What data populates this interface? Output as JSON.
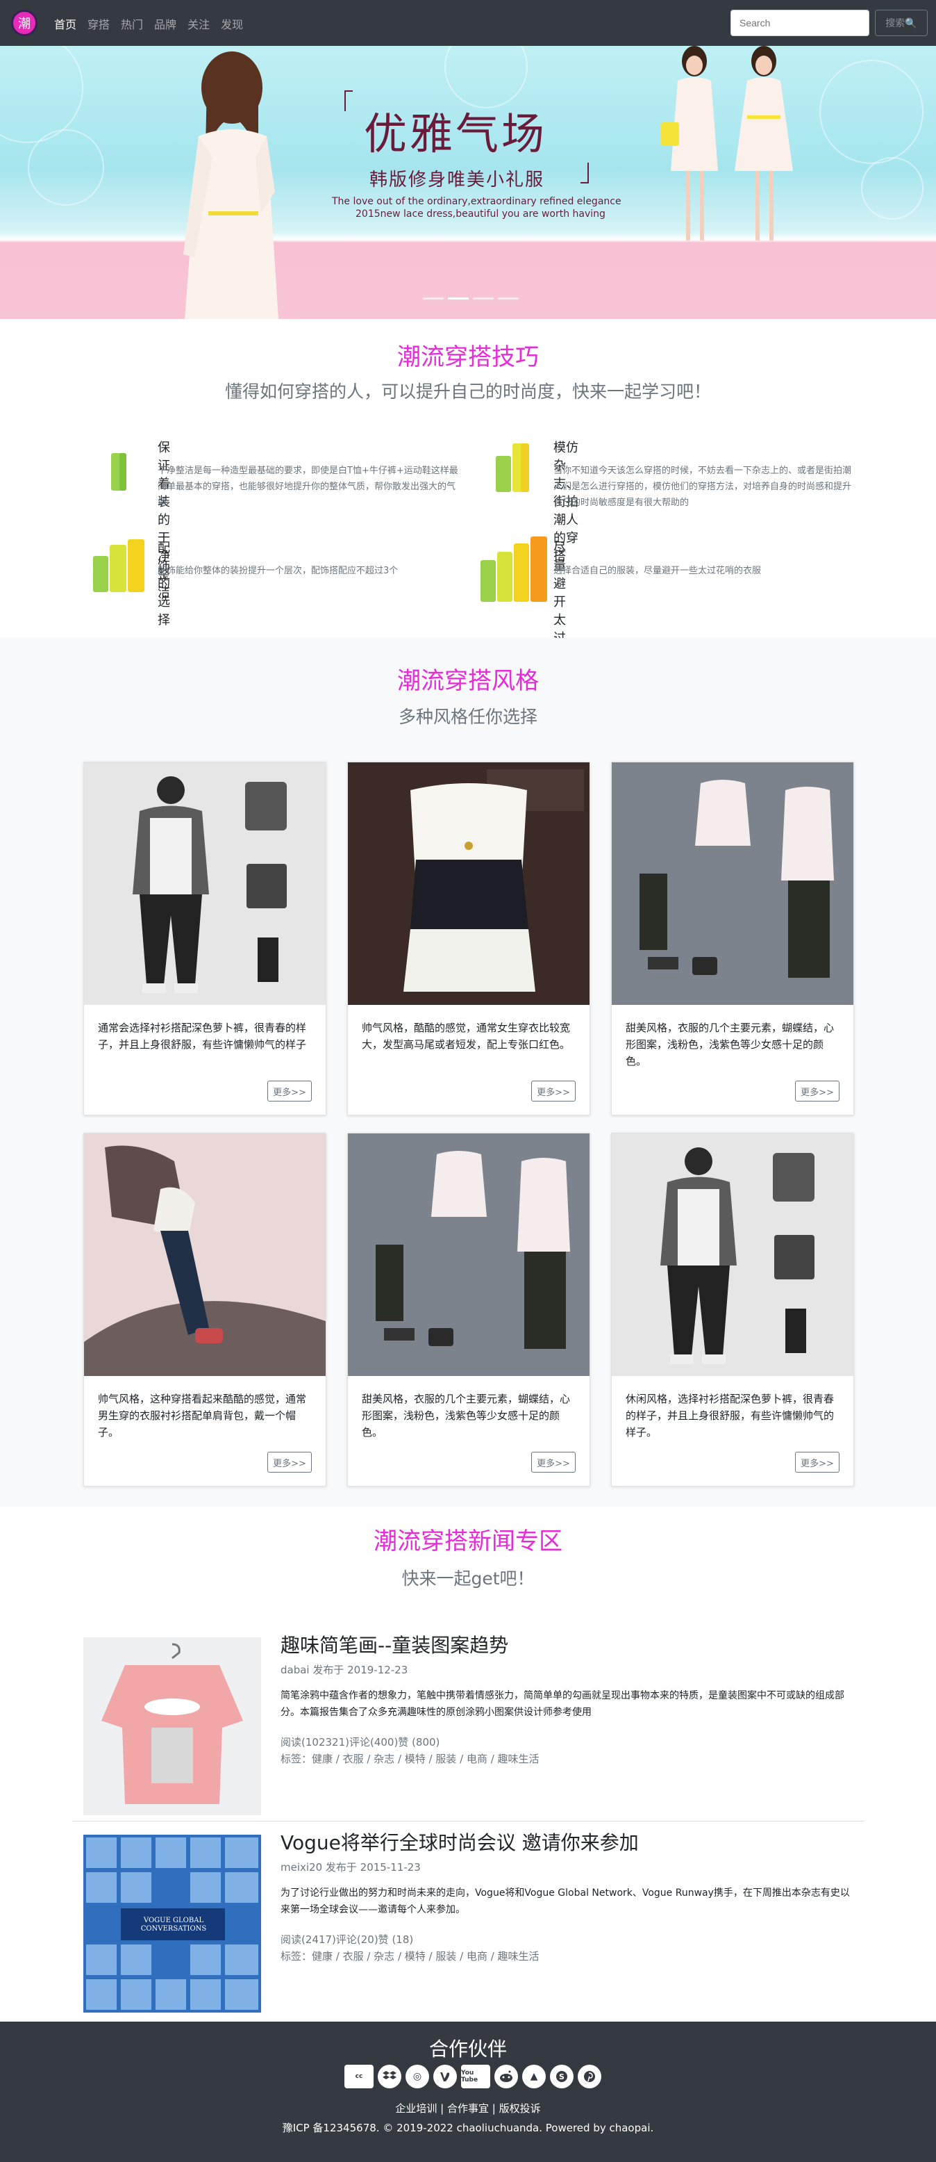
{
  "nav": {
    "brand_char": "潮",
    "links": [
      "首页",
      "穿搭",
      "热门",
      "品牌",
      "关注",
      "发现"
    ],
    "search_placeholder": "Search",
    "search_button": "搜索🔍"
  },
  "banner": {
    "title": "优雅气场",
    "subtitle": "韩版修身唯美小礼服",
    "en_line1": "The love out of the ordinary,extraordinary refined elegance",
    "en_line2": "2015new lace dress,beautiful you are worth having"
  },
  "tips": {
    "title": "潮流穿搭技巧",
    "lead": "懂得如何穿搭的人，可以提升自己的时尚度，快来一起学习吧！",
    "items": [
      {
        "heading": "保证着装的干净整洁",
        "text": "干净整洁是每一种造型最基础的要求，即使是白T恤+牛仔裤+运动鞋这样最简单最基本的穿搭，也能够很好地提升你的整体气质，帮你散发出强大的气场"
      },
      {
        "heading": "模仿杂志、街拍潮人的穿搭",
        "text": "当你不知道今天该怎么穿搭的时候，不妨去看一下杂志上的、或者是街拍潮人们是怎么进行穿搭的，模仿他们的穿搭方法，对培养自身的时尚感和提升自己的时尚敏感度是有很大帮助的"
      },
      {
        "heading": "配饰的选择",
        "text": "配饰能给你整体的装扮提升一个层次，配饰搭配应不超过3个"
      },
      {
        "heading": "尽量避开太过花哨的衣服",
        "text": "选择合适自己的服装，尽量避开一些太过花哨的衣服"
      }
    ]
  },
  "styles": {
    "title": "潮流穿搭风格",
    "lead": "多种风格任你选择",
    "more_label": "更多>>",
    "cards": [
      {
        "text": "通常会选择衬衫搭配深色萝卜裤，很青春的样子，并且上身很舒服，有些许慵懒帅气的样子"
      },
      {
        "text": "帅气风格，酷酷的感觉，通常女生穿衣比较宽大，发型高马尾或者短发，配上专张口红色。"
      },
      {
        "text": "甜美风格，衣服的几个主要元素，蝴蝶结，心形图案，浅粉色，浅紫色等少女感十足的颜色。"
      },
      {
        "text": "帅气风格，这种穿搭看起来酷酷的感觉，通常男生穿的衣服衬衫搭配单肩背包，戴一个帽子。"
      },
      {
        "text": "甜美风格，衣服的几个主要元素，蝴蝶结，心形图案，浅粉色，浅紫色等少女感十足的颜色。"
      },
      {
        "text": "休闲风格，选择衬衫搭配深色萝卜裤，很青春的样子，并且上身很舒服，有些许慵懒帅气的样子。"
      }
    ]
  },
  "news": {
    "title": "潮流穿搭新闻专区",
    "lead": "快来一起get吧！",
    "items": [
      {
        "title": "趣味简笔画--童装图案趋势",
        "meta": "dabai 发布于 2019-12-23",
        "desc": "简笔涂鸦中蕴含作者的想象力，笔触中携带着情感张力，简简单单的勾画就呈现出事物本来的特质，是童装图案中不可或缺的组成部分。本篇报告集合了众多充满趣味性的原创涂鸦小图案供设计师参考使用",
        "stats": "阅读(102321)评论(400)赞 (800)",
        "tags": "标签：健康 / 衣服 / 杂志 / 模特 / 服装 / 电商 / 趣味生活"
      },
      {
        "title": "Vogue将举行全球时尚会议 邀请你来参加",
        "meta": "meixi20 发布于 2015-11-23",
        "desc": "为了讨论行业做出的努力和时尚未来的走向，Vogue将和Vogue Global Network、Vogue Runway携手，在下周推出本杂志有史以来第一场全球会议——邀请每个人来参加。",
        "stats": "阅读(2417)评论(20)赞 (18)",
        "tags": "标签：健康 / 衣服 / 杂志 / 模特 / 服装 / 电商 / 趣味生活",
        "image_caption": "VOGUE GLOBAL CONVERSATIONS"
      }
    ]
  },
  "footer": {
    "title": "合作伙伴",
    "partners": [
      "cc",
      "dropbox",
      "◎",
      "vine",
      "You Tube",
      "reddit",
      "▲",
      "skype",
      "pinterest"
    ],
    "links": "企业培训 | 合作事宜 | 版权投诉",
    "copyright": "豫ICP 备12345678. © 2019-2022 chaoliuchuanda. Powered by chaopai."
  },
  "colors": {
    "accent": "#e82bd8",
    "navbar": "#343a40",
    "section_bg": "#f8f9fa"
  }
}
